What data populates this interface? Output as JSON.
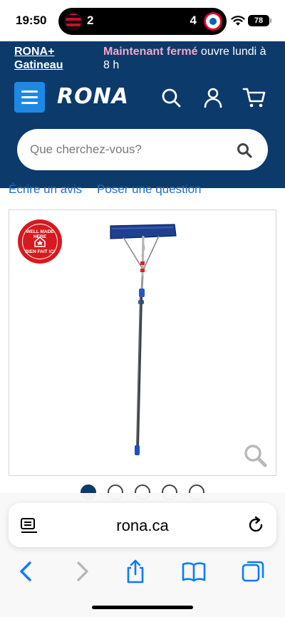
{
  "status_bar": {
    "time": "19:50",
    "score_left": "2",
    "score_right": "4",
    "battery": "78"
  },
  "store": {
    "name": "RONA+ Gatineau",
    "closed_label": "Maintenant fermé",
    "opens_text": "ouvre lundi à 8 h"
  },
  "header": {
    "logo": "RONA",
    "search_placeholder": "Que cherchez-vous?"
  },
  "review_links": {
    "write_review": "Écrire un avis",
    "ask_question": "Poser une question"
  },
  "product": {
    "badge_top": "WELL MADE HERE",
    "badge_bottom": "BIEN FAIT ICI"
  },
  "carousel": {
    "total_dots": 5,
    "active_index": 0
  },
  "browser": {
    "url": "rona.ca"
  },
  "colors": {
    "brand_navy": "#0c3a6b",
    "menu_blue": "#1e88e5",
    "closed_pink": "#f2a6c8",
    "link_blue": "#1e6fd0",
    "ios_blue": "#0a7aff"
  }
}
